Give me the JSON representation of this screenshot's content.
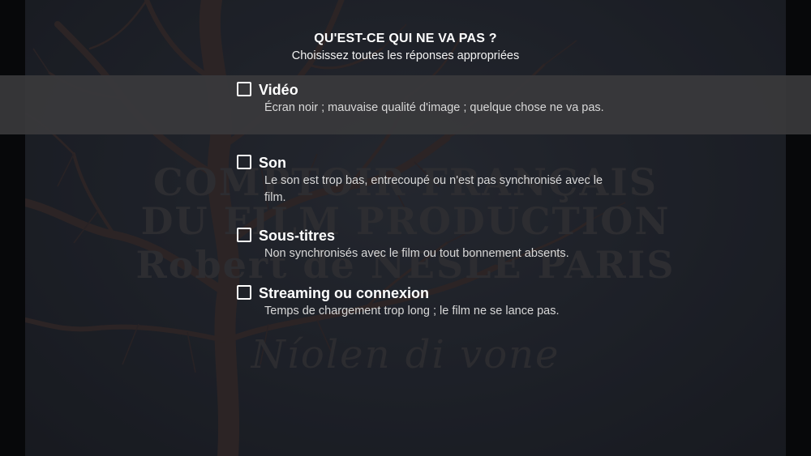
{
  "header": {
    "title": "QU'EST-CE QUI NE VA PAS ?",
    "subtitle": "Choisissez toutes les réponses appropriées"
  },
  "background": {
    "poster_lines": [
      "COMPTOIR FRANÇAIS",
      "DU FILM PRODUCTION",
      "Robert de NESLE PARIS",
      "Níolen di vone"
    ]
  },
  "options": [
    {
      "label": "Vidéo",
      "description": "Écran noir ; mauvaise qualité d'image ; quelque chose ne va pas.",
      "checked": false,
      "highlighted": true
    },
    {
      "label": "Son",
      "description": "Le son est trop bas, entrecoupé ou n'est pas synchronisé avec le film.",
      "checked": false,
      "highlighted": false
    },
    {
      "label": "Sous-titres",
      "description": "Non synchronisés avec le film ou tout bonnement absents.",
      "checked": false,
      "highlighted": false
    },
    {
      "label": "Streaming ou connexion",
      "description": "Temps de chargement trop long ; le film ne se lance pas.",
      "checked": false,
      "highlighted": false
    }
  ],
  "colors": {
    "highlight_row": "#3a3a3c",
    "text_primary": "#ffffff",
    "text_secondary": "#d8d8d8"
  }
}
